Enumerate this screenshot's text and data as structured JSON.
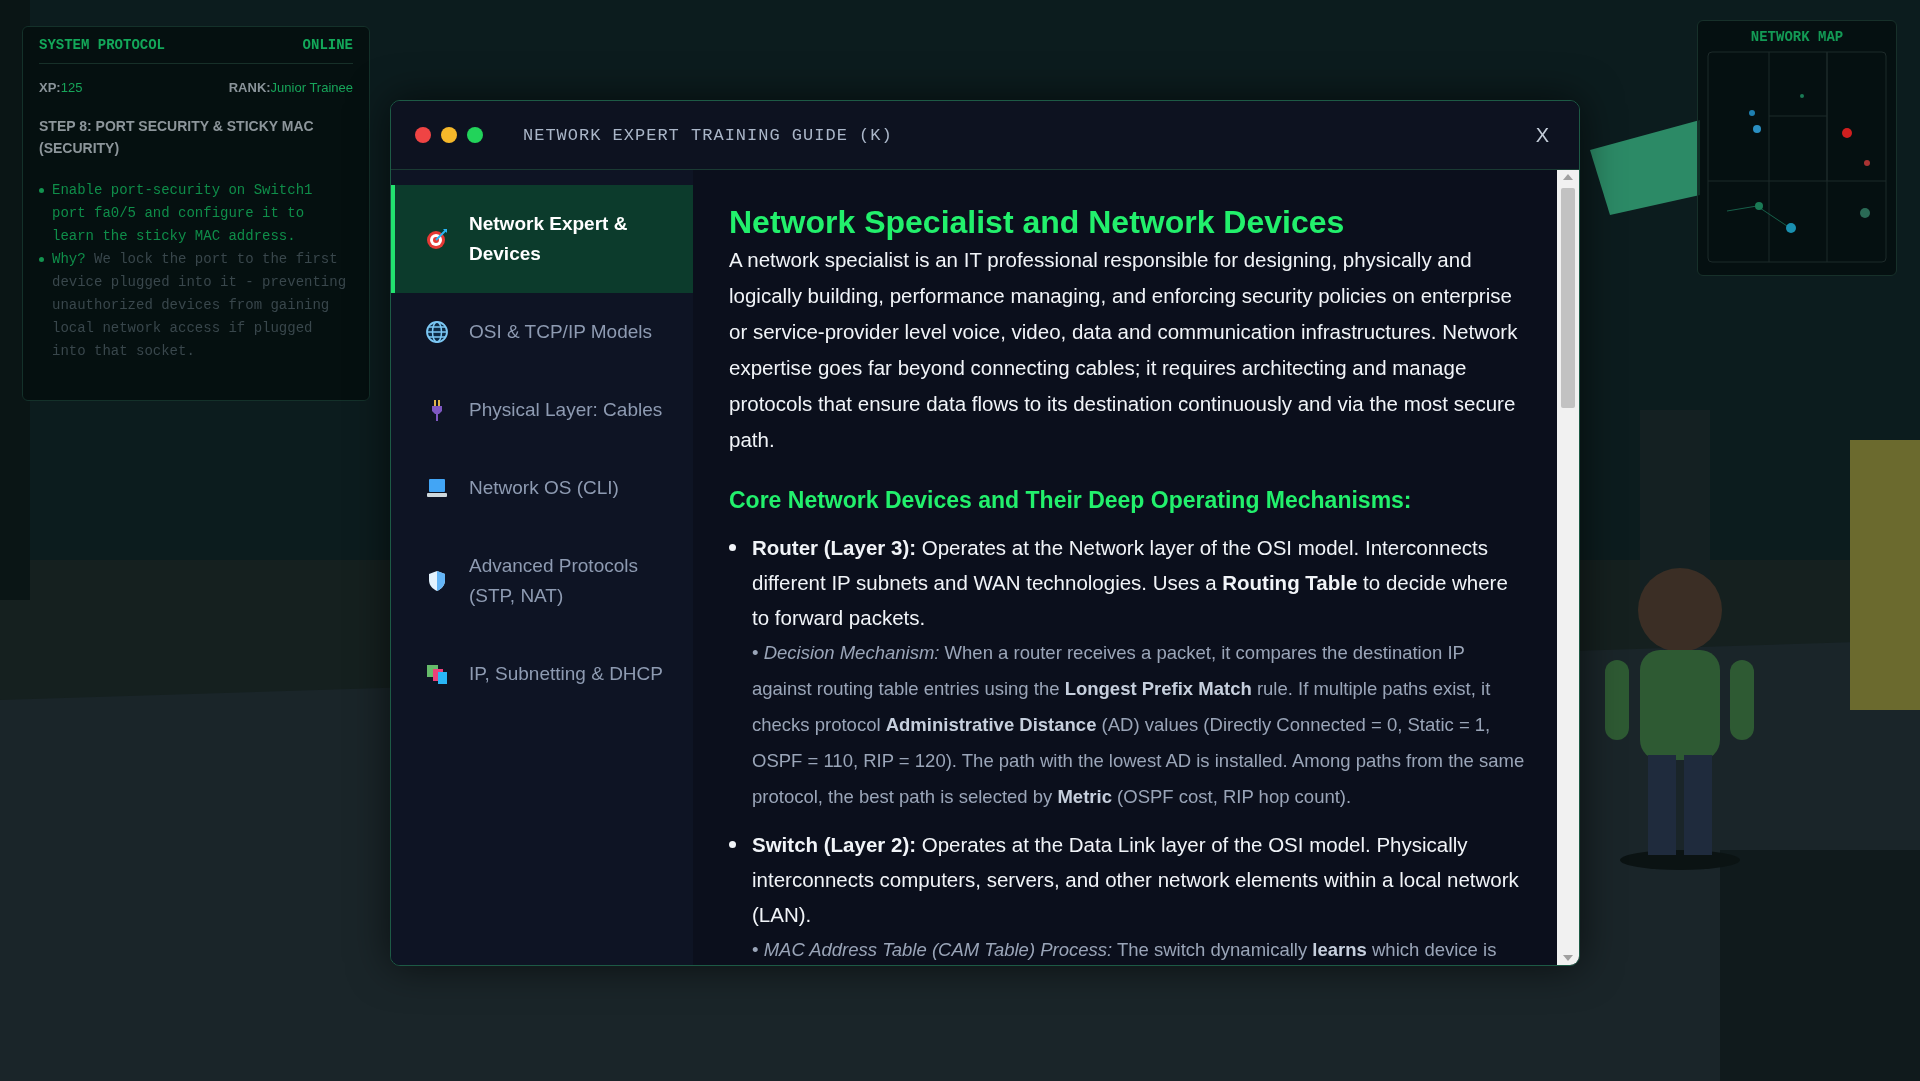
{
  "hud": {
    "title": "SYSTEM PROTOCOL",
    "status": "ONLINE",
    "xp_label": "XP:",
    "xp": "125",
    "rank_label": "RANK:",
    "rank": "Junior Trainee",
    "step": "STEP 8: PORT SECURITY & STICKY MAC (SECURITY)",
    "bullets": [
      {
        "accent": "Enable port-security on Switch1 port fa0/5 and configure it to learn the sticky MAC address."
      },
      {
        "accent": "Why?",
        "text": "We lock the port to the first device plugged into it - preventing unauthorized devices from gaining local network access if plugged into that socket."
      }
    ]
  },
  "map": {
    "title": "NETWORK MAP"
  },
  "window": {
    "title": "NETWORK EXPERT TRAINING GUIDE (K)",
    "close": "X"
  },
  "sidebar": {
    "items": [
      {
        "label": "Network Expert & Devices",
        "selected": true
      },
      {
        "label": "OSI & TCP/IP Models",
        "selected": false
      },
      {
        "label": "Physical Layer: Cables",
        "selected": false
      },
      {
        "label": "Network OS (CLI)",
        "selected": false
      },
      {
        "label": "Advanced Protocols (STP, NAT)",
        "selected": false
      },
      {
        "label": "IP, Subnetting & DHCP",
        "selected": false
      }
    ]
  },
  "article": {
    "title": "Network Specialist and Network Devices",
    "intro": "A network specialist is an IT professional responsible for designing, physically and logically building, performance managing, and enforcing security policies on enterprise or service-provider level voice, video, data and communication infrastructures. Network expertise goes far beyond connecting cables; it requires architecting and manage protocols that ensure data flows to its destination continuously and via the most secure path.",
    "section": "Core Network Devices and Their Deep Operating Mechanisms:",
    "items": [
      {
        "text": "**Router (Layer 3):** Operates at the Network layer of the OSI model. Interconnects different IP subnets and WAN technologies. Uses a **Routing Table** to decide where to forward packets.",
        "note": "• *Decision Mechanism:* When a router receives a packet, it compares the destination IP against routing table entries using the **Longest Prefix Match** rule. If multiple paths exist, it checks protocol **Administrative Distance** (AD) values (Directly Connected = 0, Static = 1, OSPF = 110, RIP = 120). The path with the lowest AD is installed. Among paths from the same protocol, the best path is selected by **Metric** (OSPF cost, RIP hop count)."
      },
      {
        "text": "**Switch (Layer 2):** Operates at the Data Link layer of the OSI model. Physically interconnects computers, servers, and other network elements within a local network (LAN).",
        "note": "• *MAC Address Table (CAM Table) Process:* The switch dynamically **learns** which device is"
      }
    ]
  }
}
